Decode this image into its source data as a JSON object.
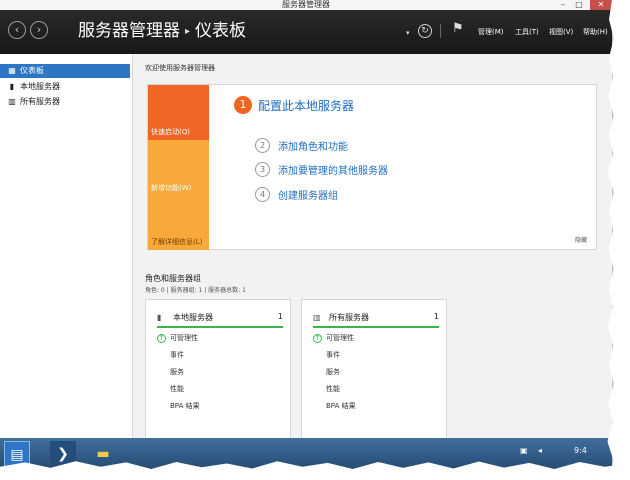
{
  "window": {
    "title": "服务器管理器",
    "controls": [
      "–",
      "□",
      "✕"
    ]
  },
  "header": {
    "breadcrumb_root": "服务器管理器",
    "breadcrumb_page": "仪表板",
    "menus": [
      "管理(M)",
      "工具(T)",
      "视图(V)",
      "帮助(H)"
    ]
  },
  "sidebar": {
    "items": [
      {
        "label": "仪表板",
        "icon": "dashboard-icon",
        "active": true
      },
      {
        "label": "本地服务器",
        "icon": "server-icon",
        "active": false
      },
      {
        "label": "所有服务器",
        "icon": "servers-icon",
        "active": false
      }
    ]
  },
  "main": {
    "welcome": "欢迎使用服务器管理器",
    "tiles": [
      "快速启动(Q)",
      "新增功能(W)",
      "了解详细信息(L)"
    ],
    "steps": [
      {
        "num": "1",
        "label": "配置此本地服务器"
      },
      {
        "num": "2",
        "label": "添加角色和功能"
      },
      {
        "num": "3",
        "label": "添加要管理的其他服务器"
      },
      {
        "num": "4",
        "label": "创建服务器组"
      }
    ],
    "hide": "隐藏",
    "roles_title": "角色和服务器组",
    "roles_summary": "角色: 0 | 服务器组: 1 | 服务器总数: 1",
    "cards": [
      {
        "name": "本地服务器",
        "count": "1",
        "rows": [
          "可管理性",
          "事件",
          "服务",
          "性能",
          "BPA 结果"
        ]
      },
      {
        "name": "所有服务器",
        "count": "1",
        "rows": [
          "可管理性",
          "事件",
          "服务",
          "性能",
          "BPA 结果"
        ]
      }
    ]
  },
  "taskbar": {
    "clock": "9:4"
  },
  "colors": {
    "accent_orange": "#ef6524",
    "tile_yellow": "#f7a93a",
    "link_blue": "#1e6dc2",
    "status_green": "#3ab54a",
    "sidebar_active": "#2e76c5"
  }
}
